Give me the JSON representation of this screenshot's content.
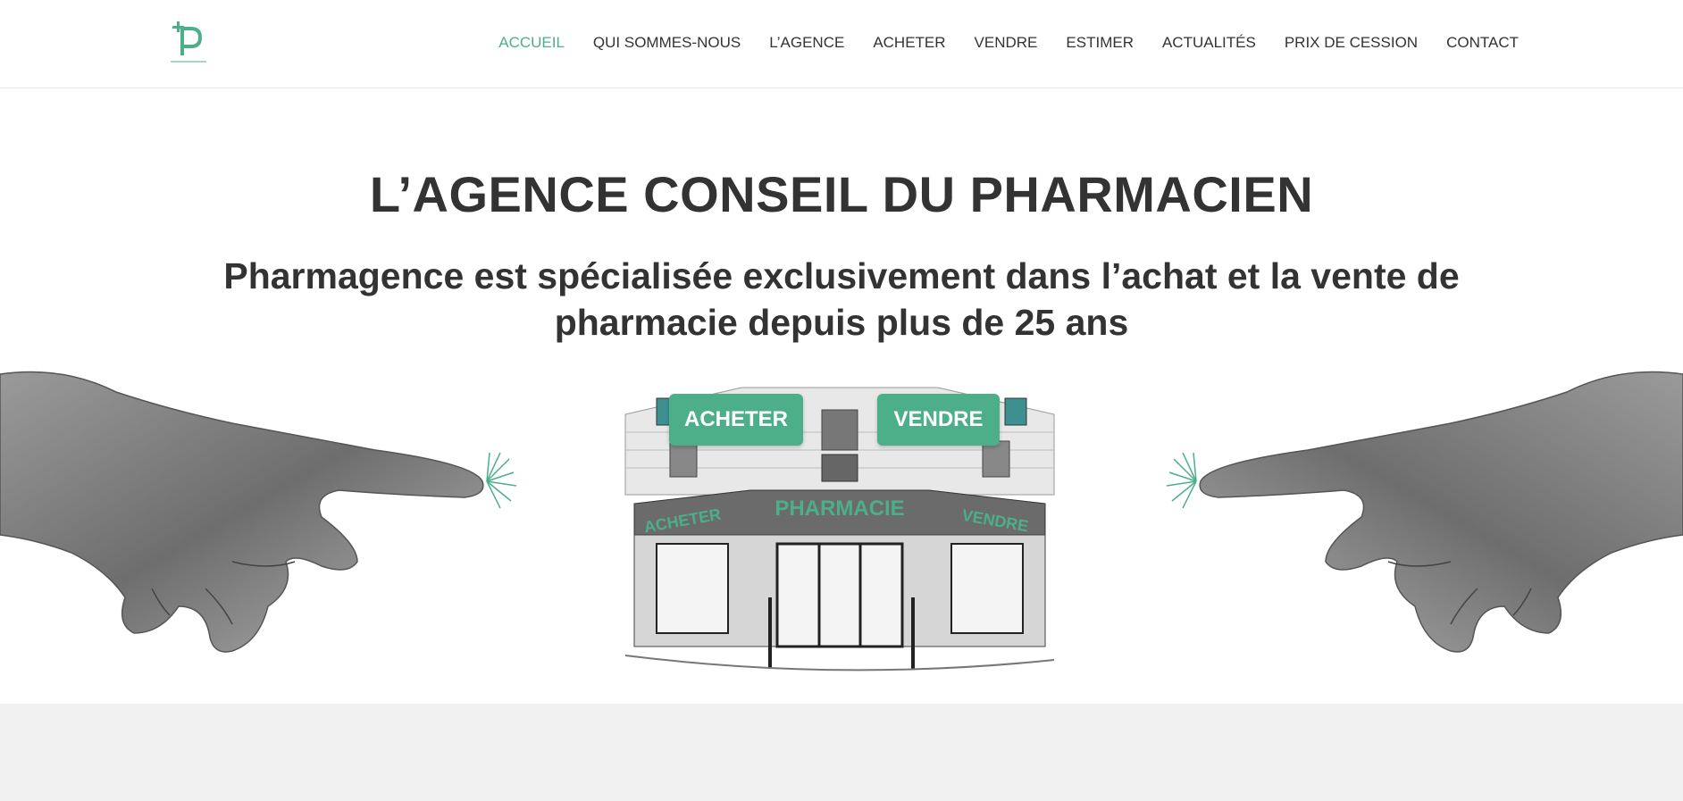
{
  "header": {
    "logo_icon": "pharmagence-logo-icon",
    "nav": [
      {
        "label": "ACCUEIL",
        "active": true
      },
      {
        "label": "QUI SOMMES-NOUS",
        "active": false
      },
      {
        "label": "L’AGENCE",
        "active": false
      },
      {
        "label": "ACHETER",
        "active": false
      },
      {
        "label": "VENDRE",
        "active": false
      },
      {
        "label": "ESTIMER",
        "active": false
      },
      {
        "label": "ACTUALITÉS",
        "active": false
      },
      {
        "label": "PRIX DE CESSION",
        "active": false
      },
      {
        "label": "CONTACT",
        "active": false
      }
    ]
  },
  "hero": {
    "title": "L’AGENCE CONSEIL DU PHARMACIEN",
    "subtitle": "Pharmagence est spécialisée exclusivement dans l’achat et la vente de pharmacie depuis plus de 25 ans",
    "buy_button": "ACHETER",
    "sell_button": "VENDRE",
    "illustration": {
      "storefront_sign": "PHARMACIE",
      "left_sign": "ACHETER",
      "right_sign": "VENDRE"
    }
  },
  "colors": {
    "accent": "#4caf8a",
    "text": "#333333",
    "footer_band": "#f1f1f1"
  }
}
